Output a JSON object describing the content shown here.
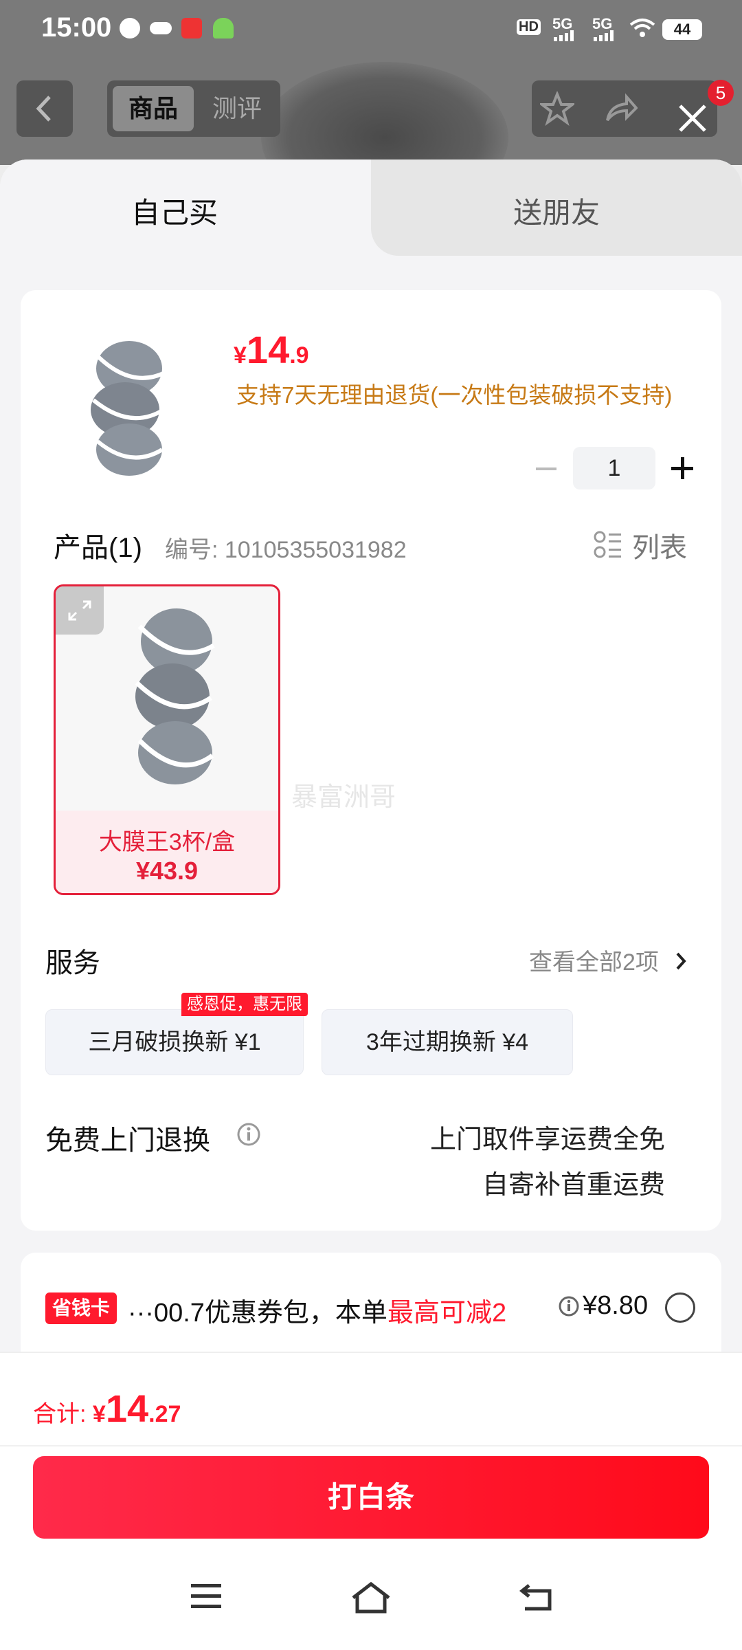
{
  "status_bar": {
    "time": "15:00",
    "network_1": "5G",
    "network_2": "5G",
    "hd_label": "HD",
    "battery": "44"
  },
  "top_bar": {
    "tab_active": "商品",
    "tab_inactive": "测评",
    "cart_badge": "5"
  },
  "sheet_tabs": {
    "self": "自己买",
    "gift": "送朋友"
  },
  "product": {
    "price_currency": "¥",
    "price_integer": "14",
    "price_decimal": ".9",
    "return_policy": "支持7天无理由退货(一次性包装破损不支持)",
    "quantity": "1",
    "section_title": "产品(1)",
    "sku_number": "编号: 10105355031982",
    "list_view_label": "列表",
    "option_name": "大膜王3杯/盒",
    "option_price": "¥43.9",
    "watermark": "暴富洲哥"
  },
  "service": {
    "title": "服务",
    "view_all": "查看全部2项",
    "promo_tag": "感恩促，惠无限",
    "option_1": "三月破损换新  ¥1",
    "option_2": "3年过期换新  ¥4",
    "return_title": "免费上门退换",
    "return_line_1": "上门取件享运费全免",
    "return_line_2": "自寄补首重运费"
  },
  "coupon": {
    "tag": "省钱卡",
    "text_prefix": "···00.7优惠券包，本单",
    "text_highlight": "最高可减2",
    "price": "¥8.80"
  },
  "total": {
    "label": "合计: ",
    "currency": "¥",
    "integer": "14",
    "decimal": ".27"
  },
  "action": {
    "button_label": "打白条"
  },
  "colors": {
    "accent_red": "#ff1a2e",
    "policy_orange": "#c77a16",
    "sku_selected_border": "#e4203a"
  }
}
